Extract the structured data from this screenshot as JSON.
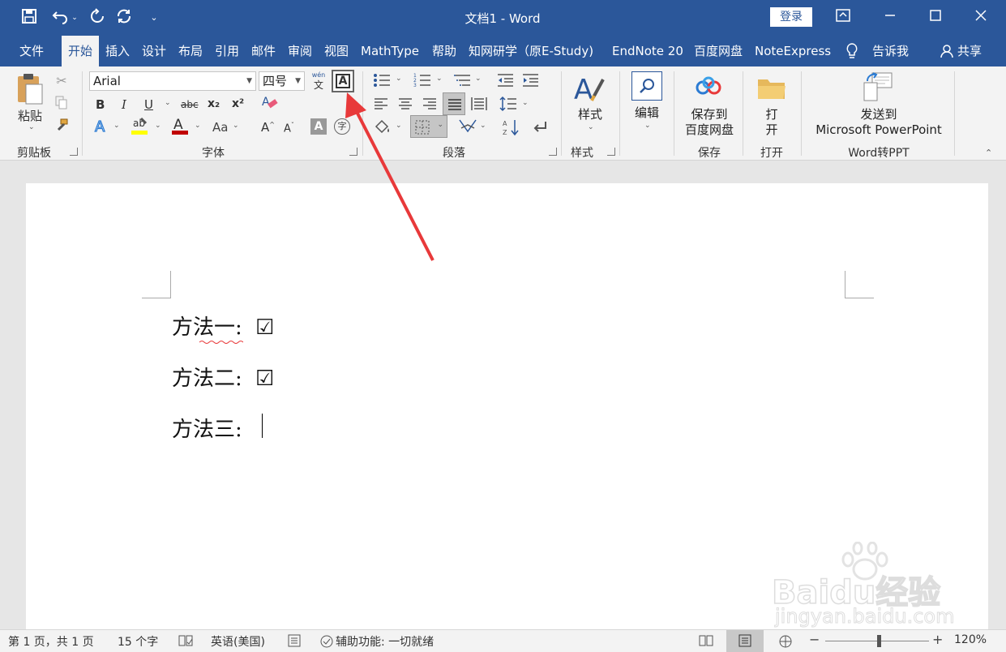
{
  "window": {
    "title": "文档1  -  Word",
    "login_label": "登录"
  },
  "tabs": [
    "文件",
    "开始",
    "插入",
    "设计",
    "布局",
    "引用",
    "邮件",
    "审阅",
    "视图",
    "MathType",
    "帮助",
    "知网研学（原E-Study)",
    "EndNote 20",
    "百度网盘",
    "NoteExpress",
    "告诉我",
    "共享"
  ],
  "ribbon": {
    "clipboard": {
      "paste_label": "粘贴",
      "group_label": "剪贴板"
    },
    "font": {
      "font_name": "Arial",
      "font_size": "四号",
      "group_label": "字体",
      "phonetic_top": "wén",
      "phonetic_bottom": "文",
      "bold": "B",
      "italic": "I",
      "underline": "U",
      "strike": "abc",
      "subscript": "x₂",
      "superscript": "x²",
      "change_case": "Aa",
      "grow": "A",
      "shrink": "A",
      "border_char": "A",
      "enclose_char": "字"
    },
    "paragraph": {
      "group_label": "段落"
    },
    "styles": {
      "label": "样式",
      "group_label": "样式"
    },
    "editing": {
      "label": "编辑"
    },
    "save": {
      "label_line1": "保存到",
      "label_line2": "百度网盘",
      "group_label": "保存"
    },
    "open": {
      "label_line1": "打",
      "label_line2": "开",
      "group_label": "打开"
    },
    "ppt": {
      "label_line1": "发送到",
      "label_line2": "Microsoft PowerPoint",
      "group_label": "Word转PPT"
    }
  },
  "document": {
    "lines": [
      {
        "label": "方法一:",
        "symbol": "☑"
      },
      {
        "label": "方法二:",
        "symbol": "☑"
      },
      {
        "label": "方法三:",
        "symbol": ""
      }
    ]
  },
  "watermark": {
    "brand": "Baidu经验",
    "url": "jingyan.baidu.com"
  },
  "status": {
    "page": "第 1 页，共 1 页",
    "words": "15 个字",
    "language": "英语(美国)",
    "accessibility": "辅助功能: 一切就绪",
    "zoom": "120%"
  },
  "colors": {
    "accent": "#2b579a",
    "arrow": "#e8393a",
    "font_color": "#c00000",
    "highlight": "#ffff00"
  }
}
